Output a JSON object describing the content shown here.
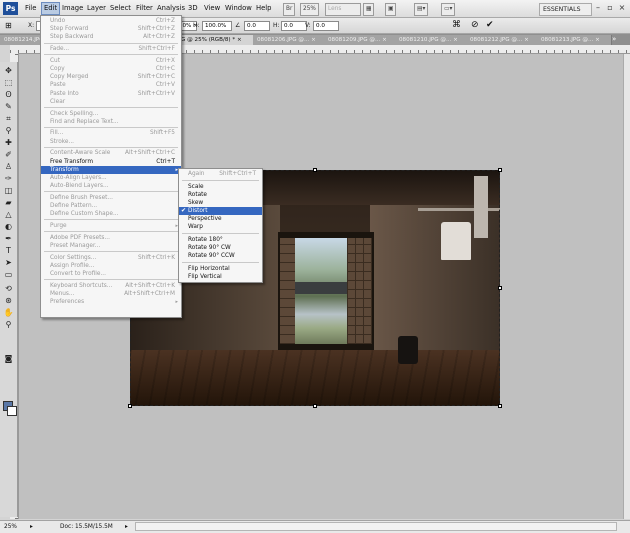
{
  "app": {
    "logo": "Ps",
    "workspace": "ESSENTIALS",
    "mini_btn": "Lens"
  },
  "menubar": {
    "items": [
      "File",
      "Edit",
      "Image",
      "Layer",
      "Select",
      "Filter",
      "Analysis",
      "3D",
      "View",
      "Window",
      "Help"
    ],
    "zoom": "25%"
  },
  "options": {
    "x_label": "X:",
    "x_value": "",
    "y_label": "Y:",
    "y_value": "",
    "w_label": "W:",
    "w_value": "100.0%",
    "h_label": "H:",
    "h_value": "100.0%",
    "angle_label": "∠",
    "angle_value": "0.0",
    "hskew_label": "H:",
    "hskew_value": "0.0",
    "vskew_label": "V:",
    "vskew_value": "0.0"
  },
  "tabs": [
    {
      "label": "08081214.JPG ..."
    },
    {
      "label": "JPG @ 25% (RGB/8) * ×",
      "active": true
    },
    {
      "label": "08081206.JPG @... ×"
    },
    {
      "label": "08081209.JPG @... ×"
    },
    {
      "label": "08081210.JPG @... ×"
    },
    {
      "label": "08081212.JPG @... ×"
    },
    {
      "label": "08081213.JPG @... ×"
    }
  ],
  "edit_menu": [
    {
      "label": "Undo",
      "shortcut": "Ctrl+Z",
      "enabled": false
    },
    {
      "label": "Step Forward",
      "shortcut": "Shift+Ctrl+Z",
      "enabled": false
    },
    {
      "label": "Step Backward",
      "shortcut": "Alt+Ctrl+Z",
      "enabled": false
    },
    {
      "sep": true
    },
    {
      "label": "Fade...",
      "shortcut": "Shift+Ctrl+F",
      "enabled": false
    },
    {
      "sep": true
    },
    {
      "label": "Cut",
      "shortcut": "Ctrl+X",
      "enabled": false
    },
    {
      "label": "Copy",
      "shortcut": "Ctrl+C",
      "enabled": false
    },
    {
      "label": "Copy Merged",
      "shortcut": "Shift+Ctrl+C",
      "enabled": false
    },
    {
      "label": "Paste",
      "shortcut": "Ctrl+V",
      "enabled": false
    },
    {
      "label": "Paste Into",
      "shortcut": "Shift+Ctrl+V",
      "enabled": false
    },
    {
      "label": "Clear",
      "shortcut": "",
      "enabled": false
    },
    {
      "sep": true
    },
    {
      "label": "Check Spelling...",
      "shortcut": "",
      "enabled": false
    },
    {
      "label": "Find and Replace Text...",
      "shortcut": "",
      "enabled": false
    },
    {
      "sep": true
    },
    {
      "label": "Fill...",
      "shortcut": "Shift+F5",
      "enabled": false
    },
    {
      "label": "Stroke...",
      "shortcut": "",
      "enabled": false
    },
    {
      "sep": true
    },
    {
      "label": "Content-Aware Scale",
      "shortcut": "Alt+Shift+Ctrl+C",
      "enabled": false
    },
    {
      "label": "Free Transform",
      "shortcut": "Ctrl+T",
      "enabled": true
    },
    {
      "label": "Transform",
      "shortcut": "",
      "enabled": true,
      "highlight": true,
      "submenu": true
    },
    {
      "label": "Auto-Align Layers...",
      "shortcut": "",
      "enabled": false
    },
    {
      "label": "Auto-Blend Layers...",
      "shortcut": "",
      "enabled": false
    },
    {
      "sep": true
    },
    {
      "label": "Define Brush Preset...",
      "shortcut": "",
      "enabled": false
    },
    {
      "label": "Define Pattern...",
      "shortcut": "",
      "enabled": false
    },
    {
      "label": "Define Custom Shape...",
      "shortcut": "",
      "enabled": false
    },
    {
      "sep": true
    },
    {
      "label": "Purge",
      "shortcut": "",
      "enabled": false,
      "submenu": true
    },
    {
      "sep": true
    },
    {
      "label": "Adobe PDF Presets...",
      "shortcut": "",
      "enabled": false
    },
    {
      "label": "Preset Manager...",
      "shortcut": "",
      "enabled": false
    },
    {
      "sep": true
    },
    {
      "label": "Color Settings...",
      "shortcut": "Shift+Ctrl+K",
      "enabled": false
    },
    {
      "label": "Assign Profile...",
      "shortcut": "",
      "enabled": false
    },
    {
      "label": "Convert to Profile...",
      "shortcut": "",
      "enabled": false
    },
    {
      "sep": true
    },
    {
      "label": "Keyboard Shortcuts...",
      "shortcut": "Alt+Shift+Ctrl+K",
      "enabled": false
    },
    {
      "label": "Menus...",
      "shortcut": "Alt+Shift+Ctrl+M",
      "enabled": false
    },
    {
      "label": "Preferences",
      "shortcut": "",
      "enabled": false,
      "submenu": true
    }
  ],
  "transform_menu": [
    {
      "label": "Again",
      "shortcut": "Shift+Ctrl+T",
      "enabled": false
    },
    {
      "sep": true
    },
    {
      "label": "Scale",
      "enabled": true
    },
    {
      "label": "Rotate",
      "enabled": true
    },
    {
      "label": "Skew",
      "enabled": true
    },
    {
      "label": "Distort",
      "enabled": true,
      "highlight": true,
      "checked": true
    },
    {
      "label": "Perspective",
      "enabled": true
    },
    {
      "label": "Warp",
      "enabled": true
    },
    {
      "sep": true
    },
    {
      "label": "Rotate 180°",
      "enabled": true
    },
    {
      "label": "Rotate 90° CW",
      "enabled": true
    },
    {
      "label": "Rotate 90° CCW",
      "enabled": true
    },
    {
      "sep": true
    },
    {
      "label": "Flip Horizontal",
      "enabled": true
    },
    {
      "label": "Flip Vertical",
      "enabled": true
    }
  ],
  "status": {
    "zoom": "25%",
    "doc": "Doc: 15.5M/15.5M"
  },
  "colors": {
    "menu_highlight": "#3567c0",
    "foreground": "#5a78a8",
    "background": "#ffffff"
  }
}
